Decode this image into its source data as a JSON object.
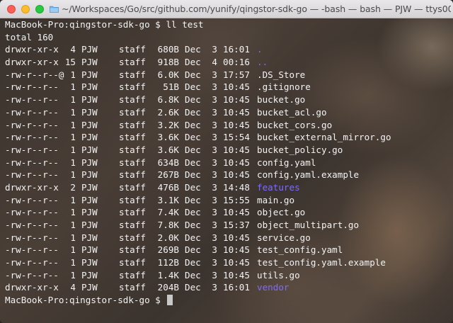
{
  "window": {
    "title": "~/Workspaces/Go/src/github.com/yunify/qingstor-sdk-go — -bash — bash — PJW — ttys00..."
  },
  "terminal": {
    "prompt_line": "MacBook-Pro:qingstor-sdk-go $ ll test",
    "total_line": "total 160",
    "entries": [
      {
        "perm": "drwxr-xr-x",
        "links": "4",
        "owner": "PJW",
        "group": "staff",
        "size": "680B",
        "month": "Dec",
        "day": "3",
        "time": "16:01",
        "name": ".",
        "is_dir": true
      },
      {
        "perm": "drwxr-xr-x",
        "links": "15",
        "owner": "PJW",
        "group": "staff",
        "size": "918B",
        "month": "Dec",
        "day": "4",
        "time": "00:16",
        "name": "..",
        "is_dir": true
      },
      {
        "perm": "-rw-r--r--@",
        "links": "1",
        "owner": "PJW",
        "group": "staff",
        "size": "6.0K",
        "month": "Dec",
        "day": "3",
        "time": "17:57",
        "name": ".DS_Store",
        "is_dir": false
      },
      {
        "perm": "-rw-r--r--",
        "links": "1",
        "owner": "PJW",
        "group": "staff",
        "size": "51B",
        "month": "Dec",
        "day": "3",
        "time": "10:45",
        "name": ".gitignore",
        "is_dir": false
      },
      {
        "perm": "-rw-r--r--",
        "links": "1",
        "owner": "PJW",
        "group": "staff",
        "size": "6.8K",
        "month": "Dec",
        "day": "3",
        "time": "10:45",
        "name": "bucket.go",
        "is_dir": false
      },
      {
        "perm": "-rw-r--r--",
        "links": "1",
        "owner": "PJW",
        "group": "staff",
        "size": "2.6K",
        "month": "Dec",
        "day": "3",
        "time": "10:45",
        "name": "bucket_acl.go",
        "is_dir": false
      },
      {
        "perm": "-rw-r--r--",
        "links": "1",
        "owner": "PJW",
        "group": "staff",
        "size": "3.2K",
        "month": "Dec",
        "day": "3",
        "time": "10:45",
        "name": "bucket_cors.go",
        "is_dir": false
      },
      {
        "perm": "-rw-r--r--",
        "links": "1",
        "owner": "PJW",
        "group": "staff",
        "size": "3.6K",
        "month": "Dec",
        "day": "3",
        "time": "15:54",
        "name": "bucket_external_mirror.go",
        "is_dir": false
      },
      {
        "perm": "-rw-r--r--",
        "links": "1",
        "owner": "PJW",
        "group": "staff",
        "size": "3.6K",
        "month": "Dec",
        "day": "3",
        "time": "10:45",
        "name": "bucket_policy.go",
        "is_dir": false
      },
      {
        "perm": "-rw-r--r--",
        "links": "1",
        "owner": "PJW",
        "group": "staff",
        "size": "634B",
        "month": "Dec",
        "day": "3",
        "time": "10:45",
        "name": "config.yaml",
        "is_dir": false
      },
      {
        "perm": "-rw-r--r--",
        "links": "1",
        "owner": "PJW",
        "group": "staff",
        "size": "267B",
        "month": "Dec",
        "day": "3",
        "time": "10:45",
        "name": "config.yaml.example",
        "is_dir": false
      },
      {
        "perm": "drwxr-xr-x",
        "links": "2",
        "owner": "PJW",
        "group": "staff",
        "size": "476B",
        "month": "Dec",
        "day": "3",
        "time": "14:48",
        "name": "features",
        "is_dir": true
      },
      {
        "perm": "-rw-r--r--",
        "links": "1",
        "owner": "PJW",
        "group": "staff",
        "size": "3.1K",
        "month": "Dec",
        "day": "3",
        "time": "15:55",
        "name": "main.go",
        "is_dir": false
      },
      {
        "perm": "-rw-r--r--",
        "links": "1",
        "owner": "PJW",
        "group": "staff",
        "size": "7.4K",
        "month": "Dec",
        "day": "3",
        "time": "10:45",
        "name": "object.go",
        "is_dir": false
      },
      {
        "perm": "-rw-r--r--",
        "links": "1",
        "owner": "PJW",
        "group": "staff",
        "size": "7.8K",
        "month": "Dec",
        "day": "3",
        "time": "15:37",
        "name": "object_multipart.go",
        "is_dir": false
      },
      {
        "perm": "-rw-r--r--",
        "links": "1",
        "owner": "PJW",
        "group": "staff",
        "size": "2.0K",
        "month": "Dec",
        "day": "3",
        "time": "10:45",
        "name": "service.go",
        "is_dir": false
      },
      {
        "perm": "-rw-r--r--",
        "links": "1",
        "owner": "PJW",
        "group": "staff",
        "size": "269B",
        "month": "Dec",
        "day": "3",
        "time": "10:45",
        "name": "test_config.yaml",
        "is_dir": false
      },
      {
        "perm": "-rw-r--r--",
        "links": "1",
        "owner": "PJW",
        "group": "staff",
        "size": "112B",
        "month": "Dec",
        "day": "3",
        "time": "10:45",
        "name": "test_config.yaml.example",
        "is_dir": false
      },
      {
        "perm": "-rw-r--r--",
        "links": "1",
        "owner": "PJW",
        "group": "staff",
        "size": "1.4K",
        "month": "Dec",
        "day": "3",
        "time": "10:45",
        "name": "utils.go",
        "is_dir": false
      },
      {
        "perm": "drwxr-xr-x",
        "links": "4",
        "owner": "PJW",
        "group": "staff",
        "size": "204B",
        "month": "Dec",
        "day": "3",
        "time": "16:01",
        "name": "vendor",
        "is_dir": true
      }
    ],
    "final_prompt": "MacBook-Pro:qingstor-sdk-go $ "
  },
  "colors": {
    "directory": "#7f6bff",
    "text": "#f3f3f3",
    "close": "#fc5f57",
    "minimize": "#fdbc2e",
    "maximize": "#28c840"
  },
  "icons": [
    "close-icon",
    "minimize-icon",
    "maximize-icon",
    "folder-icon"
  ]
}
